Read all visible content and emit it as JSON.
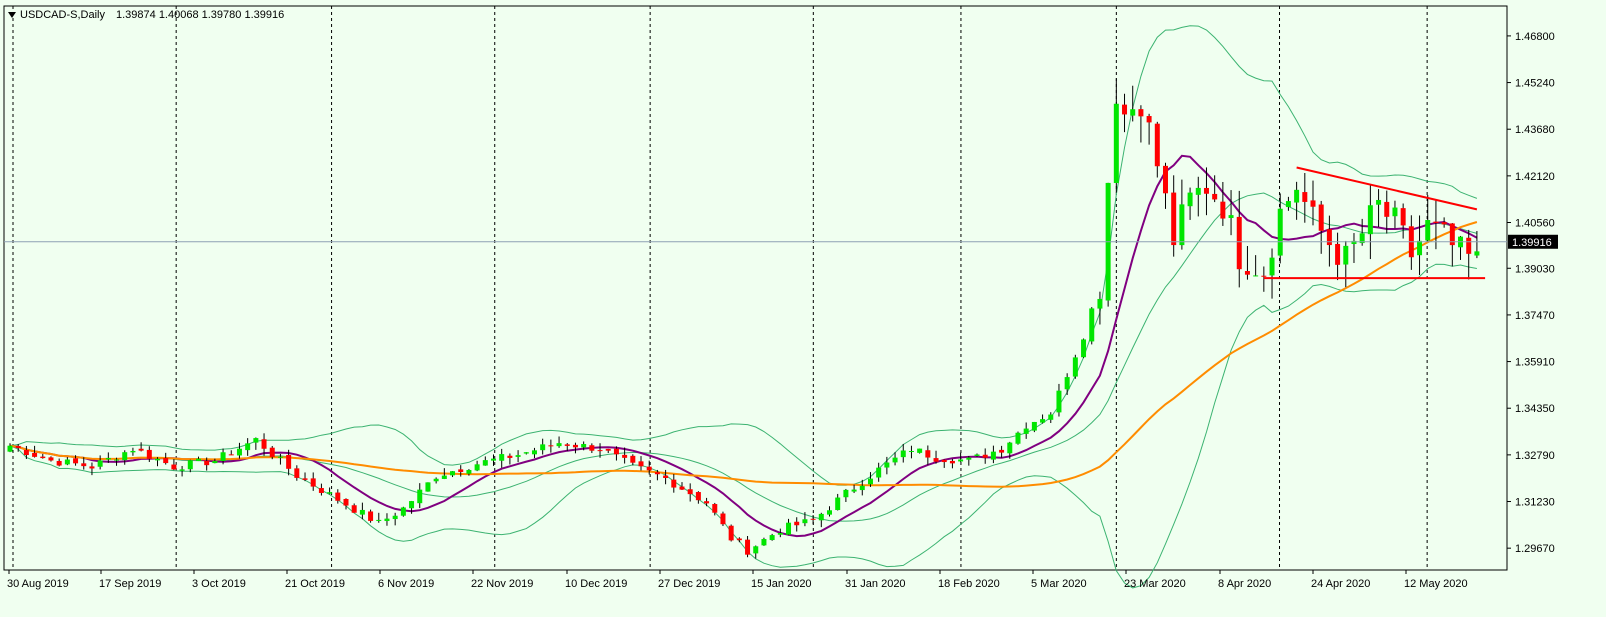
{
  "header": {
    "symbol": "USDCAD-S,Daily",
    "ohlc": "1.39874 1.40068 1.39780 1.39916"
  },
  "colors": {
    "background": "#f0fff0",
    "bull_candle": "#00e600",
    "bear_candle": "#ff0000",
    "bollinger": "#3cb371",
    "ma_fast": "#800080",
    "ma_slow": "#ff8c00",
    "trendline": "#ff0000",
    "current_price_line": "#8ea0b4"
  },
  "chart_data": {
    "type": "candlestick",
    "title": "USDCAD-S,Daily",
    "current_price": 1.39916,
    "current_price_label": "1.39916",
    "ylim": [
      1.2894,
      1.478
    ],
    "y_ticks": [
      "1.46800",
      "1.45240",
      "1.43680",
      "1.42120",
      "1.40560",
      "1.39030",
      "1.37470",
      "1.35910",
      "1.34350",
      "1.32790",
      "1.31230",
      "1.29670"
    ],
    "x_ticks": [
      "30 Aug 2019",
      "17 Sep 2019",
      "3 Oct 2019",
      "21 Oct 2019",
      "6 Nov 2019",
      "22 Nov 2019",
      "10 Dec 2019",
      "27 Dec 2019",
      "15 Jan 2020",
      "31 Jan 2020",
      "18 Feb 2020",
      "5 Mar 2020",
      "23 Mar 2020",
      "8 Apr 2020",
      "24 Apr 2020",
      "12 May 2020"
    ],
    "grid": "vertical dashed separators",
    "anchors": [
      [
        0,
        1.331
      ],
      [
        5,
        1.326
      ],
      [
        10,
        1.324
      ],
      [
        15,
        1.33
      ],
      [
        20,
        1.324
      ],
      [
        25,
        1.326
      ],
      [
        30,
        1.333
      ],
      [
        35,
        1.321
      ],
      [
        40,
        1.313
      ],
      [
        45,
        1.305
      ],
      [
        48,
        1.31
      ],
      [
        52,
        1.321
      ],
      [
        57,
        1.325
      ],
      [
        62,
        1.328
      ],
      [
        67,
        1.332
      ],
      [
        72,
        1.33
      ],
      [
        76,
        1.324
      ],
      [
        80,
        1.32
      ],
      [
        85,
        1.312
      ],
      [
        88,
        1.3
      ],
      [
        90,
        1.296
      ],
      [
        94,
        1.303
      ],
      [
        98,
        1.306
      ],
      [
        102,
        1.315
      ],
      [
        106,
        1.323
      ],
      [
        110,
        1.33
      ],
      [
        113,
        1.327
      ],
      [
        117,
        1.326
      ],
      [
        121,
        1.33
      ],
      [
        124,
        1.338
      ],
      [
        127,
        1.342
      ],
      [
        129,
        1.355
      ],
      [
        131,
        1.368
      ],
      [
        133,
        1.385
      ],
      [
        134,
        1.42
      ],
      [
        135,
        1.45
      ],
      [
        136,
        1.442
      ],
      [
        138,
        1.447
      ],
      [
        140,
        1.425
      ],
      [
        142,
        1.4
      ],
      [
        144,
        1.413
      ],
      [
        146,
        1.418
      ],
      [
        148,
        1.412
      ],
      [
        150,
        1.395
      ],
      [
        153,
        1.39
      ],
      [
        155,
        1.409
      ],
      [
        157,
        1.418
      ],
      [
        159,
        1.406
      ],
      [
        161,
        1.399
      ],
      [
        163,
        1.393
      ],
      [
        165,
        1.402
      ],
      [
        167,
        1.411
      ],
      [
        169,
        1.405
      ],
      [
        171,
        1.395
      ],
      [
        173,
        1.404
      ],
      [
        175,
        1.4
      ],
      [
        177,
        1.395
      ],
      [
        179,
        1.392
      ]
    ]
  }
}
